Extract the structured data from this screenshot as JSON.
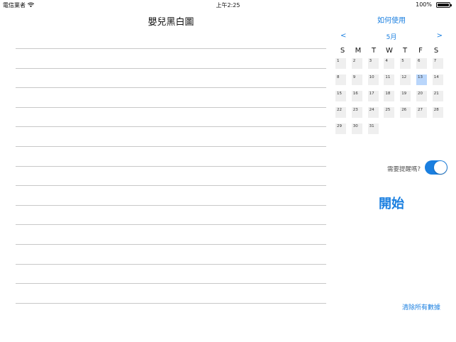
{
  "status_bar": {
    "carrier": "電信業者",
    "time": "上午2:25",
    "battery": "100%"
  },
  "main": {
    "title": "嬰兒黑白圖",
    "line_count": 14
  },
  "side": {
    "help_label": "如何使用",
    "calendar": {
      "prev_label": "<",
      "next_label": ">",
      "month_label": "5月",
      "weekdays": [
        "S",
        "M",
        "T",
        "W",
        "T",
        "F",
        "S"
      ],
      "weeks": [
        [
          "1",
          "2",
          "3",
          "4",
          "5",
          "6",
          "7"
        ],
        [
          "8",
          "9",
          "10",
          "11",
          "12",
          "13",
          "14"
        ],
        [
          "15",
          "16",
          "17",
          "18",
          "19",
          "20",
          "21"
        ],
        [
          "22",
          "23",
          "24",
          "25",
          "26",
          "27",
          "28"
        ],
        [
          "29",
          "30",
          "31",
          "",
          "",
          "",
          ""
        ]
      ],
      "selected_day": "13"
    },
    "remind_label": "需要提醒嗎?",
    "remind_on": true,
    "start_label": "開始",
    "clear_label": "清除所有數據"
  },
  "colors": {
    "accent": "#1a7fe0",
    "selected_day": "#b9d6fb",
    "day_cell": "#efefef"
  }
}
